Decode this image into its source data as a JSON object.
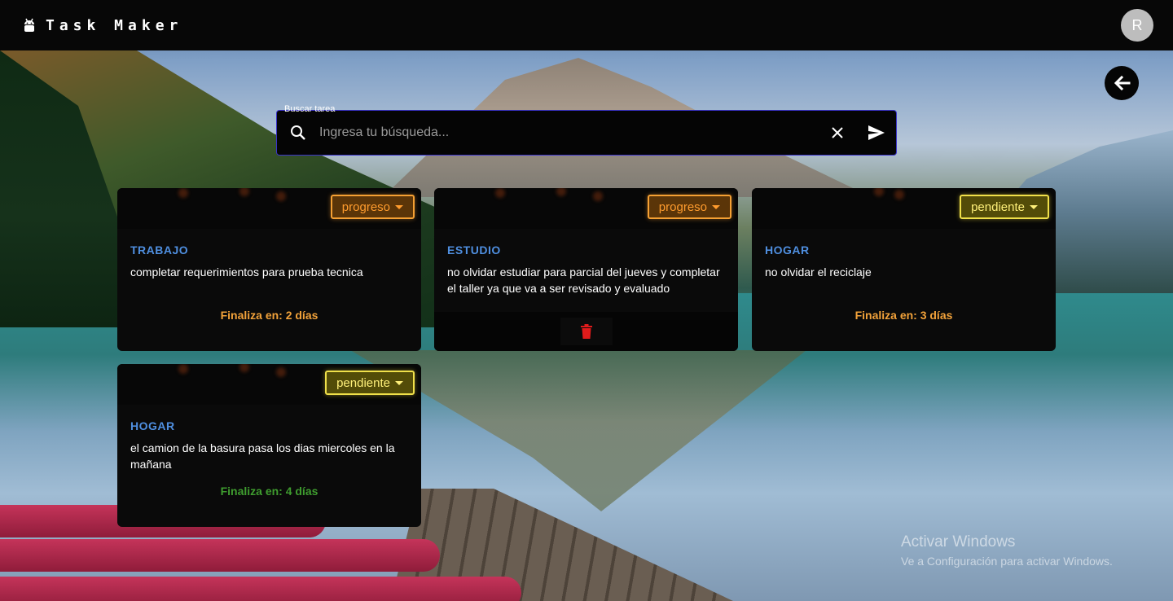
{
  "app": {
    "title": "Task Maker",
    "logo_icon": "android-icon",
    "avatar_initial": "R"
  },
  "search": {
    "label": "Buscar tarea",
    "placeholder": "Ingresa tu búsqueda...",
    "value": "",
    "focus_color": "#3a33c9"
  },
  "tasks": [
    {
      "status": "progreso",
      "category": "TRABAJO",
      "description": "completar requerimientos para prueba tecnica",
      "due": "Finaliza en: 2 días"
    },
    {
      "status": "progreso",
      "category": "ESTUDIO",
      "description": "no olvidar estudiar para parcial del jueves y completar el taller ya que va a ser revisado y evaluado",
      "due": ""
    },
    {
      "status": "pendiente",
      "category": "HOGAR",
      "description": "no olvidar el reciclaje",
      "due": "Finaliza en: 3 días"
    },
    {
      "status": "pendiente",
      "category": "HOGAR",
      "description": "el camion de la basura pasa los dias miercoles en la mañana",
      "due": "Finaliza en: 4 días"
    }
  ],
  "colors": {
    "category": "#4f8fe0",
    "progress": "#ff9c2e",
    "pending": "#fff07a",
    "due_orange": "#f2a23a",
    "due_green": "#3f9d2f",
    "delete": "#e01b1b"
  },
  "watermark": {
    "title": "Activar Windows",
    "subtitle": "Ve a Configuración para activar Windows."
  }
}
